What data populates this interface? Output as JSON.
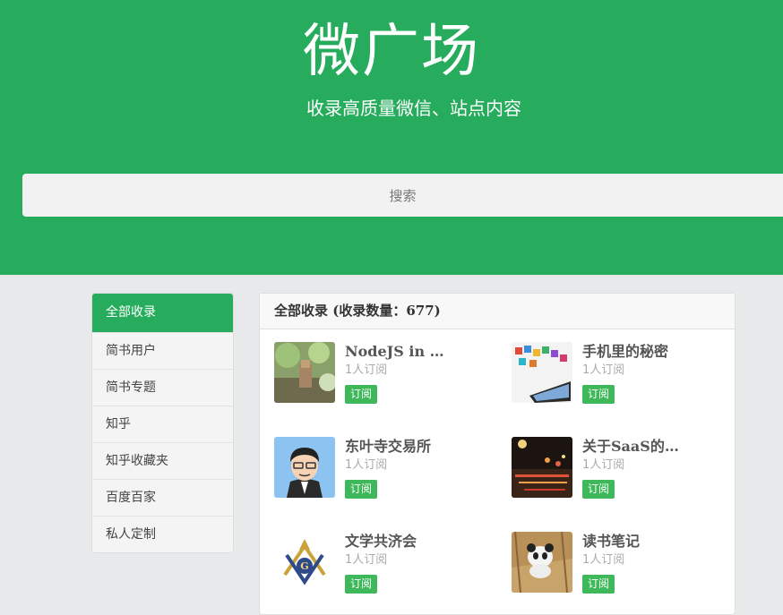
{
  "hero": {
    "title": "微广场",
    "subtitle": "收录高质量微信、站点内容",
    "search_placeholder": "搜索"
  },
  "sidebar": {
    "items": [
      {
        "label": "全部收录",
        "active": true
      },
      {
        "label": "简书用户"
      },
      {
        "label": "简书专题"
      },
      {
        "label": "知乎"
      },
      {
        "label": "知乎收藏夹"
      },
      {
        "label": "百度百家"
      },
      {
        "label": "私人定制"
      }
    ]
  },
  "panel": {
    "heading": "全部收录 (收录数量：677)",
    "cards": [
      {
        "title": "NodeJS in …",
        "subscribers": "1人订阅",
        "button": "订阅",
        "thumb_icon": "plant-photo-icon"
      },
      {
        "title": "手机里的秘密",
        "subscribers": "1人订阅",
        "button": "订阅",
        "thumb_icon": "phone-apps-icon"
      },
      {
        "title": "东叶寺交易所",
        "subscribers": "1人订阅",
        "button": "订阅",
        "thumb_icon": "cartoon-avatar-icon"
      },
      {
        "title": "关于SaaS的…",
        "subscribers": "1人订阅",
        "button": "订阅",
        "thumb_icon": "city-night-icon"
      },
      {
        "title": "文学共济会",
        "subscribers": "1人订阅",
        "button": "订阅",
        "thumb_icon": "masonic-emblem-icon"
      },
      {
        "title": "读书笔记",
        "subscribers": "1人订阅",
        "button": "订阅",
        "thumb_icon": "panda-toy-icon"
      }
    ]
  },
  "colors": {
    "brand_green": "#26ac5c",
    "button_green": "#3fb85b"
  }
}
